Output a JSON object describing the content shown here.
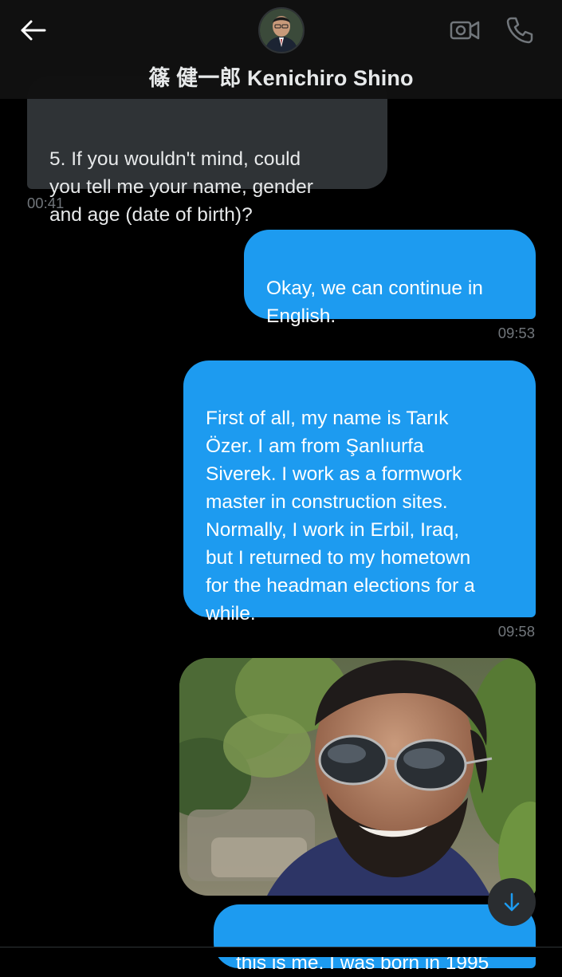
{
  "header": {
    "contact_name": "篠 健一郎 Kenichiro Shino",
    "back_icon": "arrow-left-icon",
    "video_icon": "video-camera-icon",
    "call_icon": "phone-icon"
  },
  "messages": [
    {
      "direction": "incoming",
      "text": "5. If you wouldn't mind, could\nyou tell me your name, gender\nand age (date of birth)?",
      "time": "00:41"
    },
    {
      "direction": "outgoing",
      "text": "Okay, we can continue in\nEnglish.",
      "time": "09:53"
    },
    {
      "direction": "outgoing",
      "text": "First of all, my name is Tarık\nÖzer. I am from Şanlıurfa\nSiverek. I work as a formwork\nmaster in construction sites.\nNormally, I work in Erbil, Iraq,\nbut I returned to my hometown\nfor the headman elections for a\nwhile.",
      "time": "09:58"
    },
    {
      "direction": "outgoing",
      "type": "photo",
      "icon": "photo-of-smiling-man-in-sunglasses"
    },
    {
      "direction": "outgoing",
      "text": "this is me. I was born in 1995"
    }
  ],
  "scroll_button": {
    "icon": "arrow-down-icon"
  },
  "colors": {
    "background": "#000000",
    "incoming_bubble": "#2f3336",
    "outgoing_bubble": "#1d9bf0",
    "timestamp": "#71767b"
  }
}
